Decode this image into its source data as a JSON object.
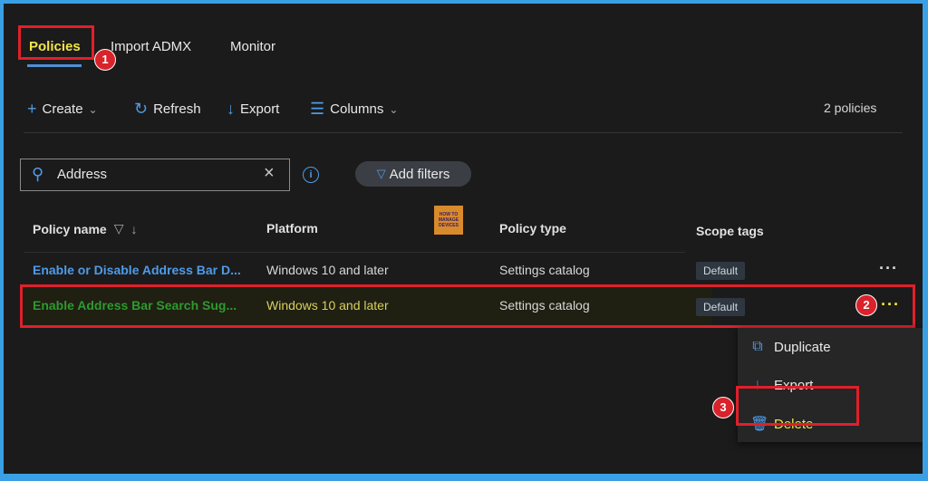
{
  "tabs": [
    {
      "label": "Policies",
      "active": true
    },
    {
      "label": "Import ADMX",
      "active": false
    },
    {
      "label": "Monitor",
      "active": false
    }
  ],
  "toolbar": {
    "create": "Create",
    "refresh": "Refresh",
    "export": "Export",
    "columns": "Columns",
    "count": "2 policies"
  },
  "search": {
    "value": "Address"
  },
  "add_filters": "Add filters",
  "columns": {
    "name": "Policy name",
    "platform": "Platform",
    "type": "Policy type",
    "scope": "Scope tags"
  },
  "rows": [
    {
      "name": "Enable or Disable Address Bar D...",
      "platform": "Windows 10 and later",
      "type": "Settings catalog",
      "scope": "Default"
    },
    {
      "name": "Enable Address Bar Search Sug...",
      "platform": "Windows 10 and later",
      "type": "Settings catalog",
      "scope": "Default"
    }
  ],
  "context_menu": {
    "duplicate": "Duplicate",
    "export": "Export",
    "delete": "Delete"
  },
  "annotations": [
    "1",
    "2",
    "3"
  ],
  "logo_text": [
    "HOW TO",
    "MANAGE",
    "DEVICES"
  ],
  "colors": {
    "accent": "#4f9be8",
    "highlight_text": "#f3e547",
    "annotation_red": "#e0202a",
    "background": "#1b1b1b"
  }
}
